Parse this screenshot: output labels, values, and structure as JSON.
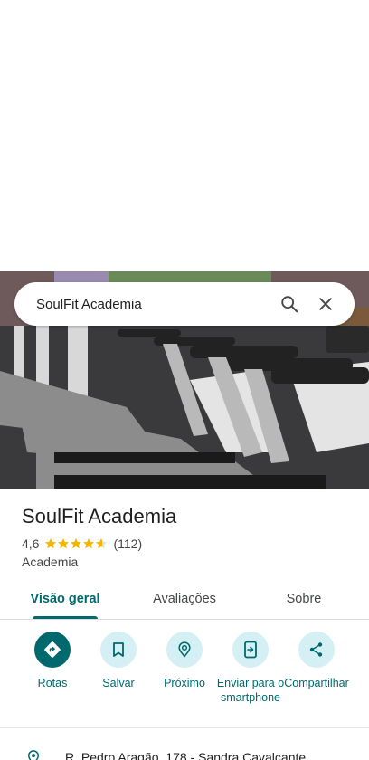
{
  "search": {
    "query": "SoulFit Academia"
  },
  "place": {
    "name": "SoulFit Academia",
    "rating": "4,6",
    "rating_value": 4.6,
    "review_count": "(112)",
    "category": "Academia",
    "address": "R. Pedro Aragão, 178 - Sandra Cavalcante"
  },
  "tabs": [
    {
      "label": "Visão geral",
      "active": true
    },
    {
      "label": "Avaliações",
      "active": false
    },
    {
      "label": "Sobre",
      "active": false
    }
  ],
  "actions": [
    {
      "label": "Rotas",
      "icon": "directions-icon"
    },
    {
      "label": "Salvar",
      "icon": "bookmark-icon"
    },
    {
      "label": "Próximo",
      "icon": "nearby-icon"
    },
    {
      "label": "Enviar para o smartphone",
      "icon": "send-to-phone-icon"
    },
    {
      "label": "Compartilhar",
      "icon": "share-icon"
    }
  ],
  "colors": {
    "accent": "#00696d",
    "accent_light": "#d4f0f4",
    "star": "#f4b400"
  }
}
